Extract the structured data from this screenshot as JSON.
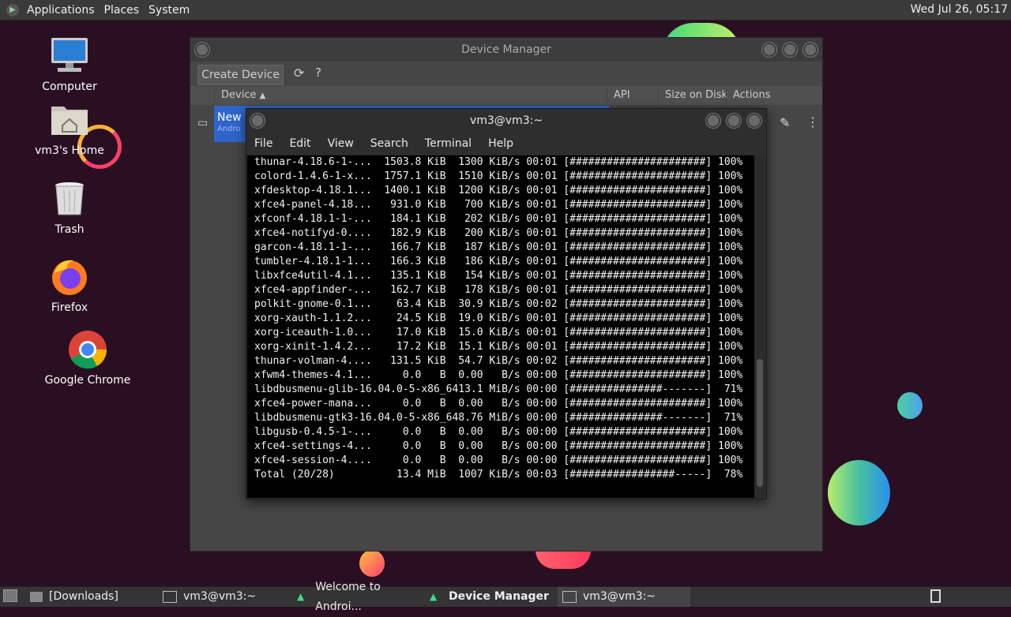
{
  "top_panel": {
    "menus": [
      "Applications",
      "Places",
      "System"
    ],
    "clock": "Wed Jul 26, 05:17"
  },
  "desktop": {
    "icons": [
      {
        "label": "Computer",
        "icon": "computer-icon"
      },
      {
        "label": "vm3's Home",
        "icon": "home-folder-icon"
      },
      {
        "label": "Trash",
        "icon": "trash-icon"
      },
      {
        "label": "Firefox",
        "icon": "firefox-icon"
      },
      {
        "label": "Google Chrome",
        "icon": "chrome-icon"
      }
    ]
  },
  "device_manager": {
    "title": "Device Manager",
    "create_button": "Create Device",
    "columns": [
      "Device",
      "API",
      "Size on Disk",
      "Actions"
    ],
    "device_name": "New D",
    "device_sub": "Andro"
  },
  "terminal": {
    "title": "vm3@vm3:~",
    "menu": [
      "File",
      "Edit",
      "View",
      "Search",
      "Terminal",
      "Help"
    ],
    "lines": [
      "thunar-4.18.6-1-...  1503.8 KiB  1300 KiB/s 00:01 [######################] 100%",
      "colord-1.4.6-1-x...  1757.1 KiB  1510 KiB/s 00:01 [######################] 100%",
      "xfdesktop-4.18.1...  1400.1 KiB  1200 KiB/s 00:01 [######################] 100%",
      "xfce4-panel-4.18...   931.0 KiB   700 KiB/s 00:01 [######################] 100%",
      "xfconf-4.18.1-1-...   184.1 KiB   202 KiB/s 00:01 [######################] 100%",
      "xfce4-notifyd-0....   182.9 KiB   200 KiB/s 00:01 [######################] 100%",
      "garcon-4.18.1-1-...   166.7 KiB   187 KiB/s 00:01 [######################] 100%",
      "tumbler-4.18.1-1...   166.3 KiB   186 KiB/s 00:01 [######################] 100%",
      "libxfce4util-4.1...   135.1 KiB   154 KiB/s 00:01 [######################] 100%",
      "xfce4-appfinder-...   162.7 KiB   178 KiB/s 00:01 [######################] 100%",
      "polkit-gnome-0.1...    63.4 KiB  30.9 KiB/s 00:02 [######################] 100%",
      "xorg-xauth-1.1.2...    24.5 KiB  19.0 KiB/s 00:01 [######################] 100%",
      "xorg-iceauth-1.0...    17.0 KiB  15.0 KiB/s 00:01 [######################] 100%",
      "xorg-xinit-1.4.2...    17.2 KiB  15.1 KiB/s 00:01 [######################] 100%",
      "thunar-volman-4....   131.5 KiB  54.7 KiB/s 00:02 [######################] 100%",
      "xfwm4-themes-4.1...     0.0   B  0.00   B/s 00:00 [######################] 100%",
      "libdbusmenu-glib-16.04.0-5-x86_6413.1 MiB/s 00:00 [###############-------]  71%",
      "xfce4-power-mana...     0.0   B  0.00   B/s 00:00 [######################] 100%",
      "libdbusmenu-gtk3-16.04.0-5-x86_648.76 MiB/s 00:00 [###############-------]  71%",
      "libgusb-0.4.5-1-...     0.0   B  0.00   B/s 00:00 [######################] 100%",
      "xfce4-settings-4...     0.0   B  0.00   B/s 00:00 [######################] 100%",
      "xfce4-session-4....     0.0   B  0.00   B/s 00:00 [######################] 100%",
      "Total (20/28)          13.4 MiB  1007 KiB/s 00:03 [#################-----]  78%"
    ]
  },
  "taskbar": {
    "items": [
      "[Downloads]",
      "vm3@vm3:~",
      "Welcome to Androi...",
      "Device Manager",
      "vm3@vm3:~"
    ]
  },
  "colors": {
    "desktop_bg": "#2a0f22",
    "selection_blue": "#2f65ca",
    "android_green": "#3ddc84"
  }
}
